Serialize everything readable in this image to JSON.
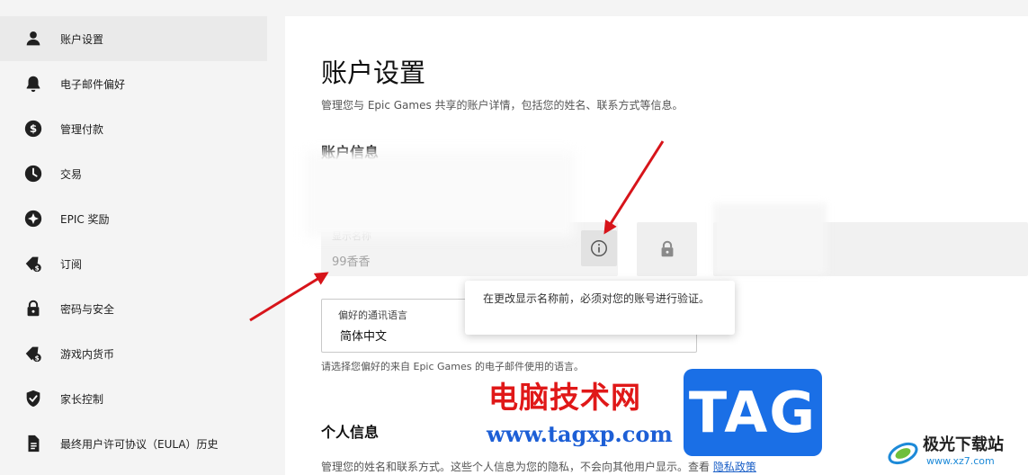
{
  "sidebar": {
    "items": [
      {
        "label": "账户设置",
        "icon": "person-icon"
      },
      {
        "label": "电子邮件偏好",
        "icon": "bell-icon"
      },
      {
        "label": "管理付款",
        "icon": "dollar-circle-icon"
      },
      {
        "label": "交易",
        "icon": "clock-icon"
      },
      {
        "label": "EPIC 奖励",
        "icon": "star-badge-icon"
      },
      {
        "label": "订阅",
        "icon": "tag-dollar-icon"
      },
      {
        "label": "密码与安全",
        "icon": "lock-icon"
      },
      {
        "label": "游戏内货币",
        "icon": "tag-dollar-icon"
      },
      {
        "label": "家长控制",
        "icon": "shield-check-icon"
      },
      {
        "label": "最终用户许可协议（EULA）历史",
        "icon": "document-icon"
      }
    ]
  },
  "main": {
    "title": "账户设置",
    "description": "管理您与 Epic Games 共享的账户详情，包括您的姓名、联系方式等信息。",
    "account_info": {
      "title": "账户信息",
      "display_name": {
        "label": "显示名称",
        "value": "99香香"
      },
      "tooltip": "在更改显示名称前，必须对您的账号进行验证。"
    },
    "language": {
      "label": "偏好的通讯语言",
      "value": "简体中文",
      "help": "请选择您偏好的来自 Epic Games 的电子邮件使用的语言。"
    },
    "personal_info": {
      "title": "个人信息",
      "description": "管理您的姓名和联系方式。这些个人信息为您的隐私，不会向其他用户显示。查看",
      "privacy_link": "隐私政策"
    }
  },
  "watermark": {
    "title": "电脑技术网",
    "url": "www.tagxp.com",
    "tag": "TAG",
    "site_name": "极光下载站",
    "site_url": "www.xz7.com"
  },
  "colors": {
    "annotation_arrow": "#d7141a",
    "link": "#1a5fc7",
    "watermark_red": "#e01818",
    "watermark_blue": "#1a6fe6"
  }
}
